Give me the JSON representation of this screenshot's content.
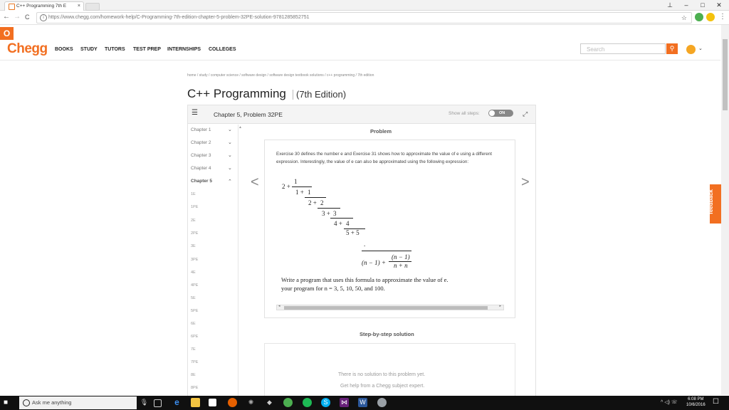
{
  "browser": {
    "tab_title": "C++ Programming 7th E",
    "tab_close": "×",
    "url": "https://www.chegg.com/homework-help/C-Programming-7th-edition-chapter-5-problem-32PE-solution-9781285852751",
    "back": "←",
    "forward": "→",
    "reload": "C",
    "info": "i",
    "star": "☆",
    "menu": "⋮",
    "win_user": "⊥",
    "win_min": "–",
    "win_max": "□",
    "win_close": "✕"
  },
  "header": {
    "logo_glyph": "O",
    "brand": "Chegg",
    "nav": [
      "BOOKS",
      "STUDY",
      "TUTORS",
      "TEST PREP",
      "INTERNSHIPS",
      "COLLEGES"
    ],
    "search_placeholder": "Search",
    "avatar_chevron": "⌄"
  },
  "page": {
    "breadcrumb": "home / study / computer science / software design / software design textbook solutions / c++ programming / 7th edition",
    "book_title": "C++ Programming",
    "edition": "(7th Edition)",
    "chapter_problem": "Chapter 5, Problem 32PE",
    "show_all_steps": "Show all steps:",
    "toggle_label": "ON",
    "problem_heading": "Problem",
    "problem_text": "Exercise 30 defines the number e and Exercise 31 shows how to approximate the value of e using a different expression. Interestingly, the value of e can also be approximated using the following expression:",
    "instruction_line1": "Write a program that uses this formula to approximate the value of e.",
    "instruction_line2": "your program for n = 3, 5, 10, 50, and 100.",
    "stepbystep_heading": "Step-by-step solution",
    "no_solution": "There is no solution to this problem yet.",
    "get_help": "Get help from a Chegg subject expert.",
    "feedback": "feedback",
    "prev_arrow": "<",
    "next_arrow": ">"
  },
  "formula": {
    "t1": "2 +",
    "n1": "1",
    "t2": "1 +",
    "n2": "1",
    "t3": "2 +",
    "n3": "2",
    "t4": "3 +",
    "n4": "3",
    "t5": "4 +",
    "n5": "4",
    "t6": "5 + 5",
    "dots": ".",
    "last_left": "(n − 1) +",
    "last_num": "(n − 1)",
    "last_den": "n + n"
  },
  "chapters": [
    {
      "label": "Chapter 1",
      "chev": "⌄"
    },
    {
      "label": "Chapter 2",
      "chev": "⌄"
    },
    {
      "label": "Chapter 3",
      "chev": "⌄"
    },
    {
      "label": "Chapter 4",
      "chev": "⌄"
    },
    {
      "label": "Chapter 5",
      "chev": "⌃"
    }
  ],
  "problems": [
    "1E",
    "1PE",
    "2E",
    "2PE",
    "3E",
    "3PE",
    "4E",
    "4PE",
    "5E",
    "5PE",
    "6E",
    "6PE",
    "7E",
    "7PE",
    "8E",
    "8PE"
  ],
  "taskbar": {
    "start": "■",
    "cortana": "Ask me anything",
    "mic": "🎙",
    "tray": "^ ◁) ☏",
    "time": "6:08 PM",
    "date": "10/6/2016",
    "notifications": "☐"
  }
}
